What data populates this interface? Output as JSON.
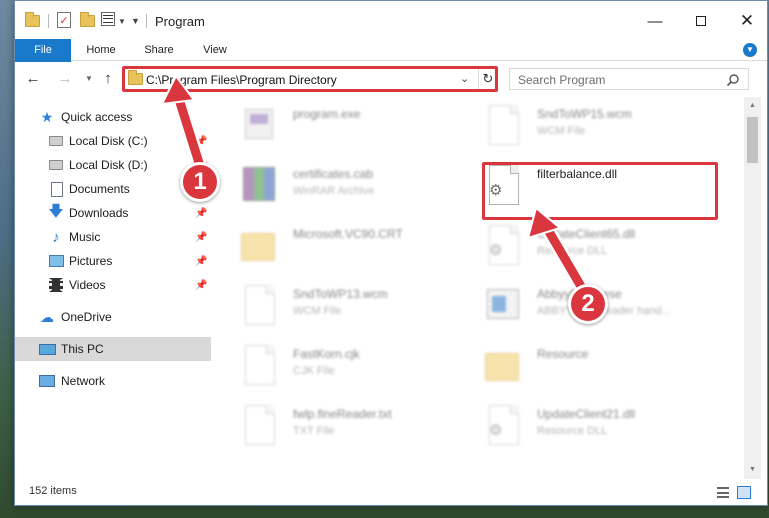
{
  "window": {
    "title": "Program",
    "minimize_glyph": "—",
    "close_glyph": "✕"
  },
  "ribbon": {
    "tabs": [
      {
        "label": "File"
      },
      {
        "label": "Home"
      },
      {
        "label": "Share"
      },
      {
        "label": "View"
      }
    ]
  },
  "address": {
    "path": "C:\\Program Files\\Program Directory",
    "search_placeholder": "Search Program"
  },
  "sidebar": {
    "items": [
      {
        "label": "Quick access",
        "icon": "star-icon",
        "pinned": false
      },
      {
        "label": "Local Disk (C:)",
        "icon": "drive-icon",
        "pinned": true
      },
      {
        "label": "Local Disk (D:)",
        "icon": "drive-icon",
        "pinned": true
      },
      {
        "label": "Documents",
        "icon": "documents-icon",
        "pinned": true
      },
      {
        "label": "Downloads",
        "icon": "download-icon",
        "pinned": true
      },
      {
        "label": "Music",
        "icon": "music-icon",
        "pinned": true
      },
      {
        "label": "Pictures",
        "icon": "pictures-icon",
        "pinned": true
      },
      {
        "label": "Videos",
        "icon": "videos-icon",
        "pinned": true
      },
      {
        "label": "OneDrive",
        "icon": "cloud-icon",
        "pinned": false
      },
      {
        "label": "This PC",
        "icon": "computer-icon",
        "pinned": false,
        "selected": true
      },
      {
        "label": "Network",
        "icon": "network-icon",
        "pinned": false
      }
    ]
  },
  "files": [
    {
      "name": "program.exe",
      "desc": "",
      "icon": "exe-icon"
    },
    {
      "name": "SndToWP15.wcm",
      "desc": "WCM File",
      "icon": "document-icon"
    },
    {
      "name": "certificates.cab",
      "desc": "WinRAR Archive",
      "icon": "archive-icon"
    },
    {
      "name": "filterbalance.dll",
      "desc": "",
      "icon": "dll-icon",
      "highlighted": true
    },
    {
      "name": "Microsoft.VC90.CRT",
      "desc": "",
      "icon": "folder-icon"
    },
    {
      "name": "UpdateClient65.dll",
      "desc": "Resource DLL",
      "icon": "dll-icon"
    },
    {
      "name": "SndToWP13.wcm",
      "desc": "WCM File",
      "icon": "document-icon"
    },
    {
      "name": "AbbyyFineRese",
      "desc": "ABBYY FineReader hand...",
      "icon": "app-icon"
    },
    {
      "name": "FastKorn.cjk",
      "desc": "CJK File",
      "icon": "document-icon"
    },
    {
      "name": "Resource",
      "desc": "",
      "icon": "folder-icon"
    },
    {
      "name": "fwlp.fineReader.txt",
      "desc": "TXT File",
      "icon": "document-icon"
    },
    {
      "name": "UpdateClient21.dll",
      "desc": "Resource DLL",
      "icon": "dll-icon"
    }
  ],
  "status": {
    "item_count": "152 items"
  },
  "callouts": {
    "step1": "1",
    "step2": "2"
  },
  "colors": {
    "accent": "#1979ca",
    "highlight": "#d9363e",
    "selected_nav": "#d9d9d9"
  }
}
